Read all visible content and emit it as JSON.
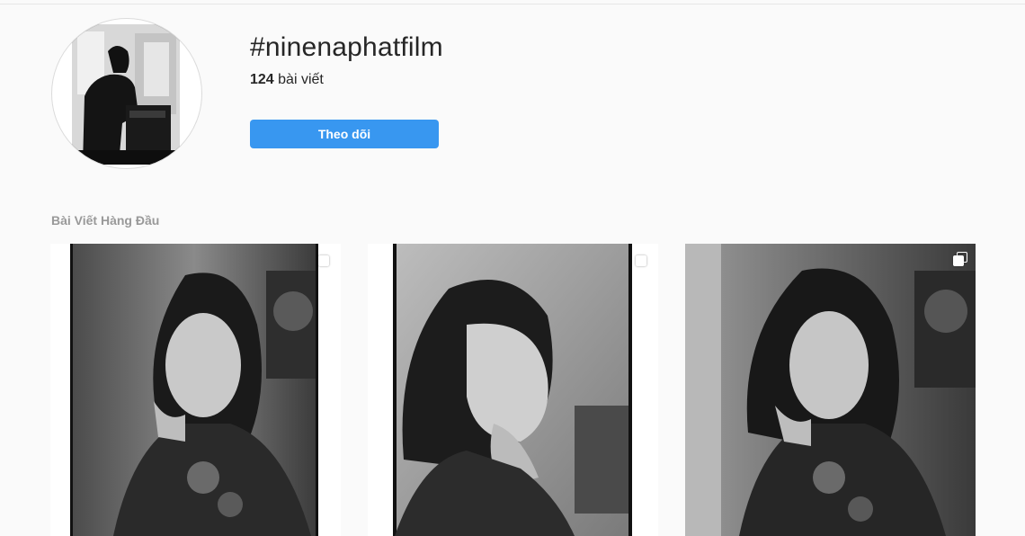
{
  "hashtag": {
    "title": "#ninenaphatfilm",
    "post_count": "124",
    "post_count_label": "bài viết",
    "follow_label": "Theo dõi"
  },
  "top_posts": {
    "label": "Bài Viết Hàng Đầu",
    "posts": [
      {
        "icon": "multiple-photos-icon"
      },
      {
        "icon": "multiple-photos-icon"
      },
      {
        "icon": "multiple-photos-icon"
      }
    ]
  },
  "colors": {
    "accent": "#3897f0",
    "background": "#fafafa",
    "muted_text": "#999999"
  }
}
